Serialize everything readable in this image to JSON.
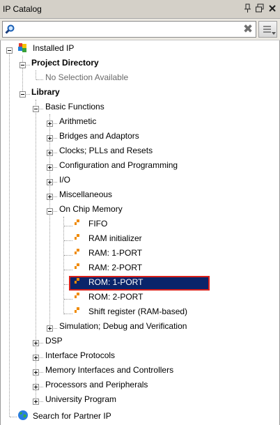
{
  "panel": {
    "title": "IP Catalog",
    "pin_icon": "pin-icon",
    "restore_icon": "restore-icon",
    "close_icon": "close-icon"
  },
  "search": {
    "value": "",
    "placeholder": "",
    "icon": "search-icon",
    "clear_icon": "clear-icon",
    "menu_icon": "hamburger-menu-icon"
  },
  "tree": {
    "installed_ip": "Installed IP",
    "project_directory": "Project Directory",
    "no_selection": "No Selection Available",
    "library": "Library",
    "basic_functions": "Basic Functions",
    "basic_items": [
      "Arithmetic",
      "Bridges and Adaptors",
      "Clocks; PLLs and Resets",
      "Configuration and Programming",
      "I/O",
      "Miscellaneous"
    ],
    "on_chip_memory": "On Chip Memory",
    "memory_items": [
      "FIFO",
      "RAM initializer",
      "RAM: 1-PORT",
      "RAM: 2-PORT",
      "ROM: 1-PORT",
      "ROM: 2-PORT",
      "Shift register (RAM-based)"
    ],
    "simulation": "Simulation; Debug and Verification",
    "library_items": [
      "DSP",
      "Interface Protocols",
      "Memory Interfaces and Controllers",
      "Processors and Peripherals",
      "University Program"
    ],
    "partner_ip": "Search for Partner IP",
    "selected_item": "ROM: 1-PORT"
  },
  "colors": {
    "selection_bg": "#0a246a",
    "selection_border": "#d9201a",
    "ip_icon": "#f08a00"
  }
}
